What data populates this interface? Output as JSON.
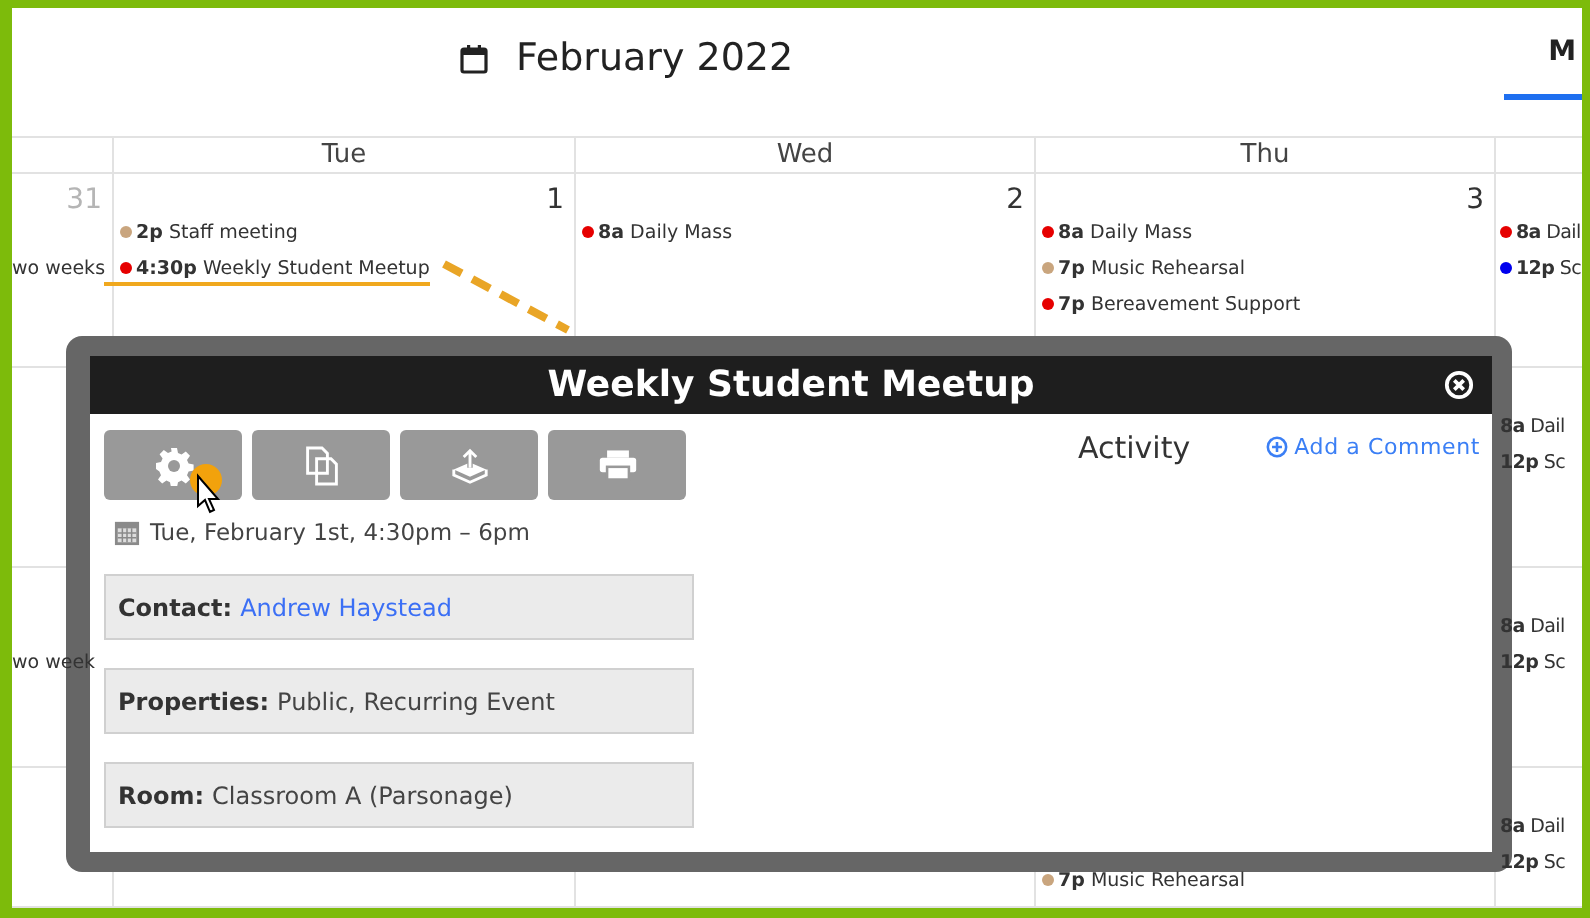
{
  "header": {
    "title": "February 2022",
    "view_tab": {
      "label": "M",
      "selected": true
    }
  },
  "calendar": {
    "day_headers": {
      "tue": "Tue",
      "wed": "Wed",
      "thu": "Thu"
    },
    "weeks": [
      {
        "column_1": {
          "date": "31",
          "muted": true,
          "events": [
            {
              "title": "wo weeks"
            }
          ]
        },
        "tue": {
          "date": "1",
          "muted": false,
          "events": [
            {
              "time": "2p",
              "title": "Staff meeting",
              "color": "#c9a57e"
            },
            {
              "time": "4:30p",
              "title": "Weekly Student Meetup",
              "color": "#e60000"
            }
          ]
        },
        "wed": {
          "date": "2",
          "muted": false,
          "events": [
            {
              "time": "8a",
              "title": "Daily Mass",
              "color": "#e60000"
            }
          ]
        },
        "thu": {
          "date": "3",
          "muted": false,
          "events": [
            {
              "time": "8a",
              "title": "Daily Mass",
              "color": "#e60000"
            },
            {
              "time": "7p",
              "title": "Music Rehearsal",
              "color": "#c9a57e"
            },
            {
              "time": "7p",
              "title": "Bereavement Support",
              "color": "#e60000"
            }
          ]
        },
        "column_5": {
          "events": [
            {
              "time": "8a",
              "title": "Dail",
              "color": "#e60000"
            },
            {
              "time": "12p",
              "title": "Sc",
              "color": "#0000ee"
            }
          ]
        }
      },
      {
        "column_5": {
          "events": [
            {
              "time": "8a",
              "title": "Dail"
            },
            {
              "time": "12p",
              "title": "Sc"
            }
          ]
        }
      },
      {
        "column_1": {
          "events": [
            {
              "title": "wo week"
            }
          ]
        },
        "column_5": {
          "events": [
            {
              "time": "8a",
              "title": "Dail"
            },
            {
              "time": "12p",
              "title": "Sc"
            }
          ]
        }
      },
      {
        "thu": {
          "events": [
            {
              "time": "7p",
              "title": "Music Rehearsal",
              "color": "#c9a57e"
            }
          ]
        },
        "column_5": {
          "events": [
            {
              "time": "8a",
              "title": "Dail"
            },
            {
              "time": "12p",
              "title": "Sc"
            }
          ]
        }
      }
    ]
  },
  "dialog": {
    "title": "Weekly Student Meetup",
    "toolbar": [
      {
        "kind": "settings"
      },
      {
        "kind": "copy"
      },
      {
        "kind": "export"
      },
      {
        "kind": "print"
      }
    ],
    "when": "Tue, February 1st, 4:30pm – 6pm",
    "fields": [
      {
        "label": "Contact:",
        "value": "Andrew Haystead",
        "kind": "link"
      },
      {
        "label": "Properties:",
        "value": "Public, Recurring Event",
        "kind": "text"
      },
      {
        "label": "Room:",
        "value": "Classroom A (Parsonage)",
        "kind": "text"
      }
    ],
    "activity": {
      "title": "Activity",
      "add_link": "Add a Comment"
    }
  }
}
